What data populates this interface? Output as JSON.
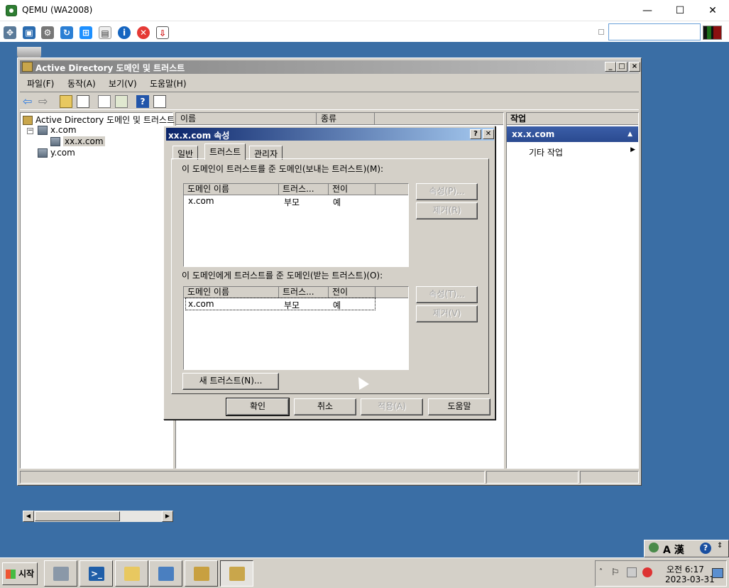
{
  "host": {
    "window_title": "QEMU (WA2008)",
    "controls": {
      "minimize": "—",
      "maximize": "☐",
      "close": "✕"
    },
    "search_value": ""
  },
  "mmc": {
    "title": "Active Directory 도메인 및 트러스트",
    "menu": [
      "파일(F)",
      "동작(A)",
      "보기(V)",
      "도움말(H)"
    ],
    "tree": {
      "root": "Active Directory 도메인 및 트러스트",
      "nodes": [
        {
          "label": "x.com",
          "expanded": true
        },
        {
          "label": "xx.x.com",
          "selected": true
        },
        {
          "label": "y.com"
        }
      ]
    },
    "list_columns": [
      "이름",
      "종류"
    ],
    "actions": {
      "header": "작업",
      "section": "xx.x.com",
      "item": "기타 작업"
    }
  },
  "dialog": {
    "title": "xx.x.com 속성",
    "help_btn": "?",
    "close_btn": "✕",
    "tabs": [
      "일반",
      "트러스트",
      "관리자"
    ],
    "active_tab": "트러스트",
    "outgoing": {
      "label": "이 도메인이 트러스트를 준 도메인(보내는 트러스트)(M):",
      "columns": [
        "도메인 이름",
        "트러스...",
        "전이"
      ],
      "rows": [
        [
          "x.com",
          "부모",
          "예"
        ]
      ],
      "properties_btn": "속성(P)...",
      "remove_btn": "제거(R)"
    },
    "incoming": {
      "label": "이 도메인에게 트러스트를 준 도메인(받는 트러스트)(O):",
      "columns": [
        "도메인 이름",
        "트러스...",
        "전이"
      ],
      "rows": [
        [
          "x.com",
          "부모",
          "예"
        ]
      ],
      "properties_btn": "속성(T)...",
      "remove_btn": "제거(V)"
    },
    "new_trust_btn": "새 트러스트(N)...",
    "ok": "확인",
    "cancel": "취소",
    "apply": "적용(A)",
    "help": "도움말"
  },
  "taskbar": {
    "start": "시작",
    "clock_time": "오전 6:17",
    "clock_date": "2023-03-31",
    "lang": "A 漢"
  }
}
